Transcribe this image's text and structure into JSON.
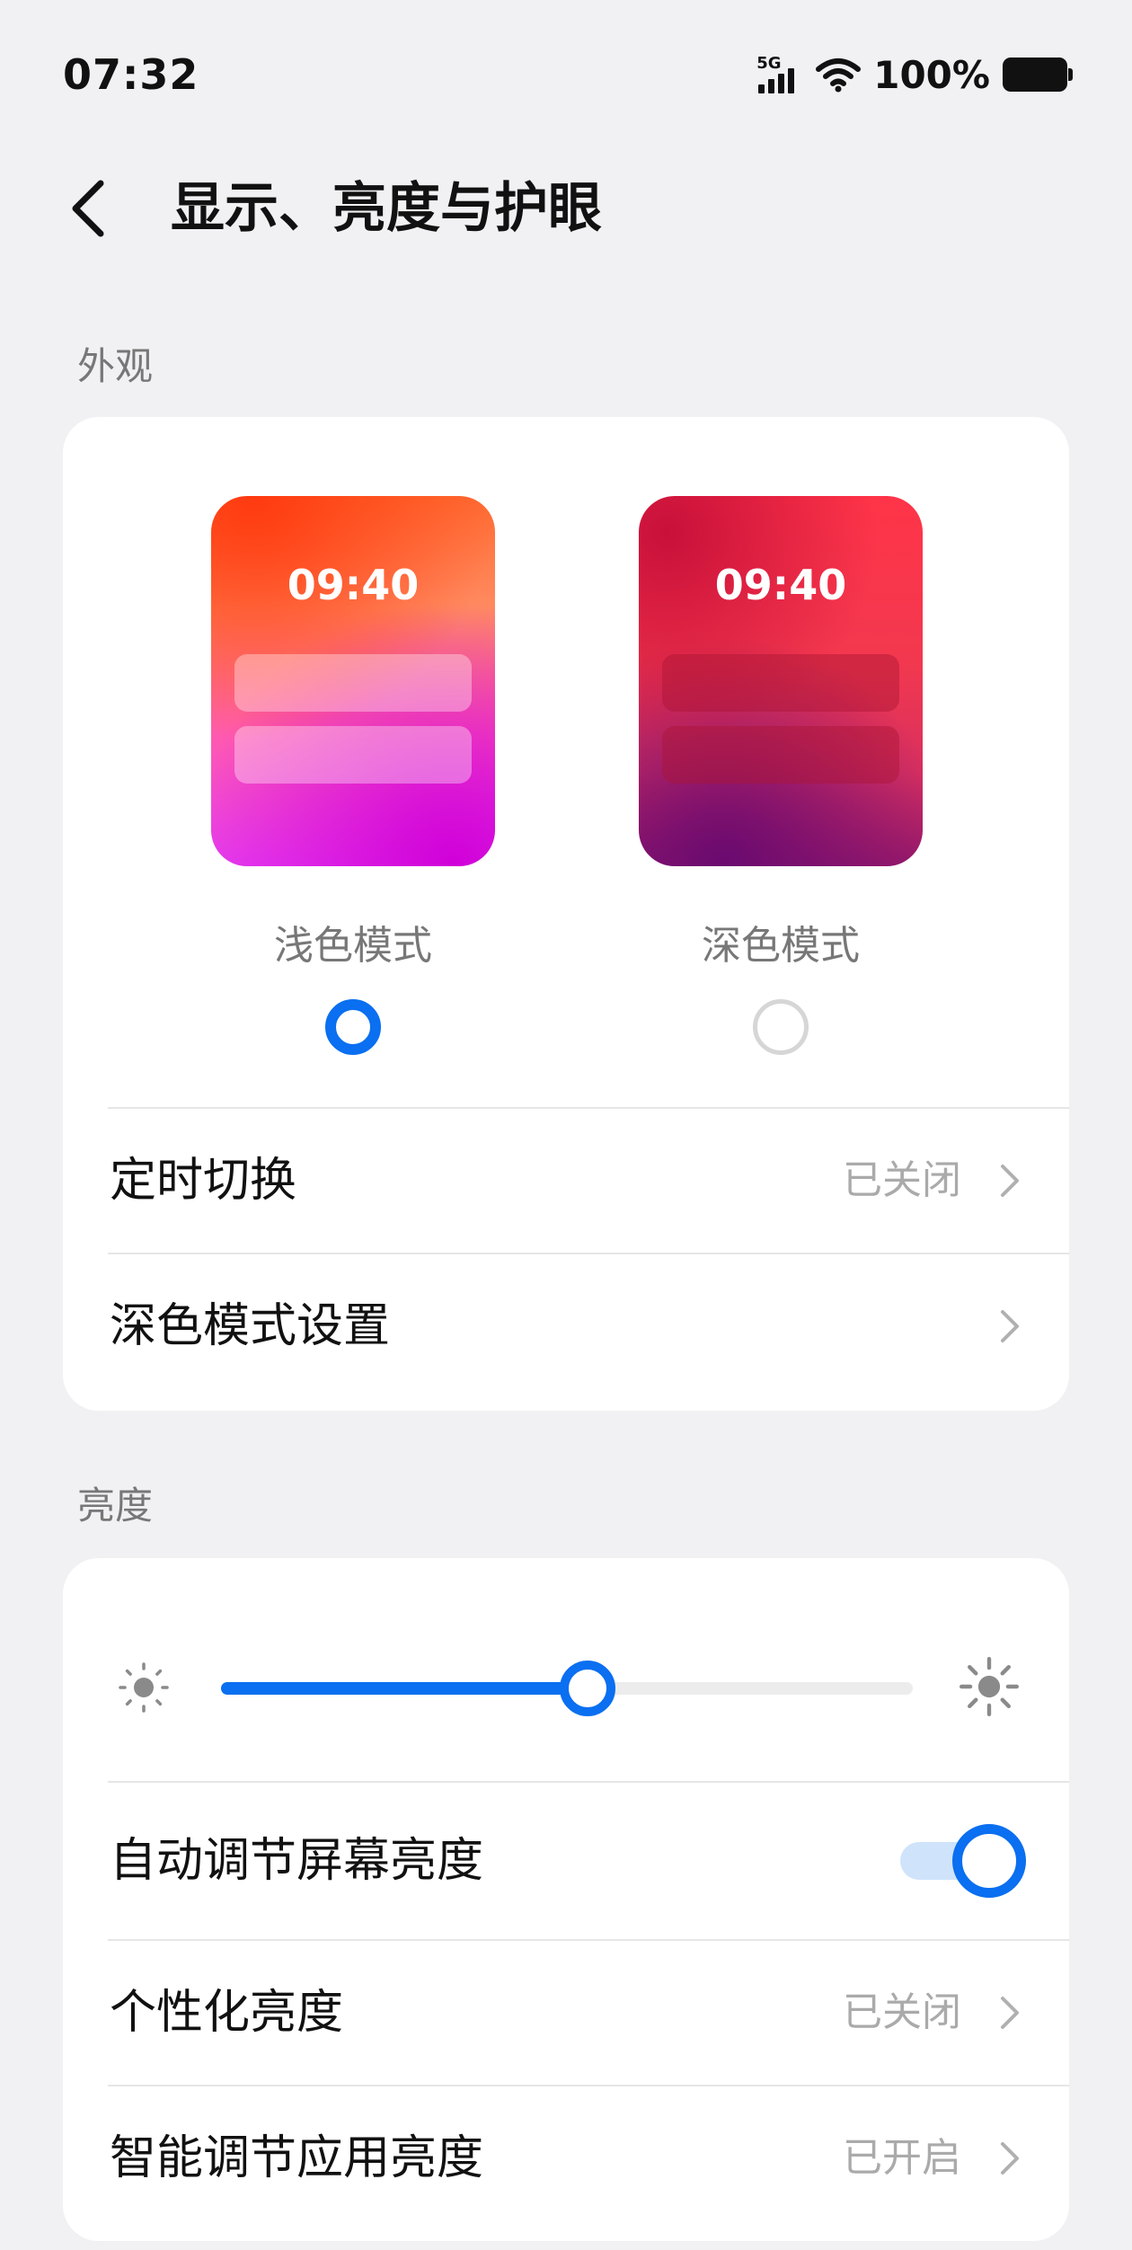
{
  "status_bar": {
    "time": "07:32",
    "network": "5G",
    "battery_percent": "100%"
  },
  "header": {
    "title": "显示、亮度与护眼"
  },
  "appearance": {
    "section_label": "外观",
    "modes": [
      {
        "label": "浅色模式",
        "preview_time": "09:40",
        "selected": true
      },
      {
        "label": "深色模式",
        "preview_time": "09:40",
        "selected": false
      }
    ],
    "rows": [
      {
        "label": "定时切换",
        "value": "已关闭"
      },
      {
        "label": "深色模式设置",
        "value": ""
      }
    ]
  },
  "brightness": {
    "section_label": "亮度",
    "slider_level_percent": 53,
    "rows": [
      {
        "label": "自动调节屏幕亮度",
        "toggle_on": true
      },
      {
        "label": "个性化亮度",
        "value": "已关闭"
      },
      {
        "label": "智能调节应用亮度",
        "value": "已开启"
      }
    ]
  },
  "colors": {
    "accent": "#0a6ff0",
    "background": "#f1f1f4",
    "card": "#ffffff",
    "secondary_text": "#aaaaaa"
  },
  "icons": [
    "back-arrow-icon",
    "signal-icon",
    "wifi-icon",
    "battery-icon",
    "sun-low-icon",
    "sun-high-icon",
    "chevron-right-icon"
  ]
}
